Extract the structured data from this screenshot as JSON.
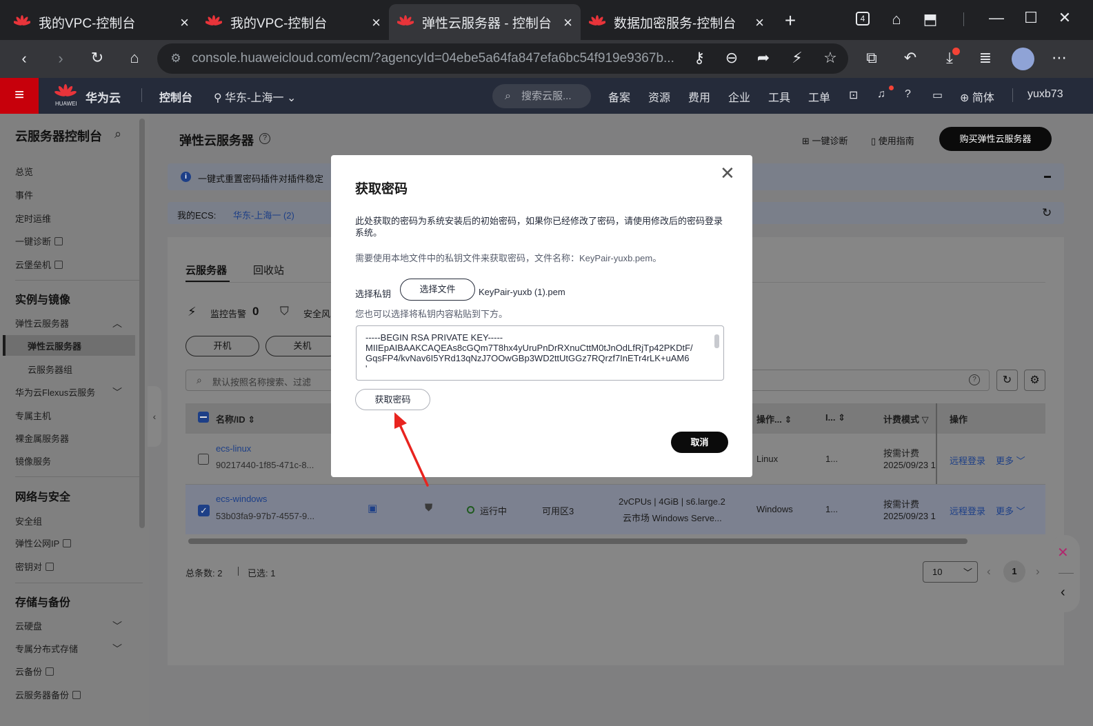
{
  "browser": {
    "tabs": [
      {
        "title": "我的VPC-控制台",
        "close": "×"
      },
      {
        "title": "我的VPC-控制台",
        "close": "×"
      },
      {
        "title": "弹性云服务器 - 控制台",
        "close": "×"
      },
      {
        "title": "数据加密服务-控制台",
        "close": "×"
      }
    ],
    "new_tab": "+",
    "tab_count": "4",
    "url": "console.huaweicloud.com/ecm/?agencyId=04ebe5a64fa847efa6bc54f919e9367b...",
    "window_controls": {
      "minimize": "—",
      "maximize": "☐",
      "close": "✕"
    }
  },
  "header": {
    "brand_text": "华为云",
    "brand_small": "HUAWEI",
    "console": "控制台",
    "region": "华东-上海一",
    "search_placeholder": "搜索云服...",
    "nav": [
      "备案",
      "资源",
      "费用",
      "企业",
      "工具",
      "工单"
    ],
    "language": "简体",
    "user": "yuxb73"
  },
  "sidebar": {
    "title": "云服务器控制台",
    "items_top": [
      "总览",
      "事件",
      "定时运维",
      "一键诊断",
      "云堡垒机"
    ],
    "group_instances": "实例与镜像",
    "instances": [
      "弹性云服务器",
      "弹性云服务器",
      "云服务器组",
      "华为云Flexus云服务",
      "专属主机",
      "裸金属服务器",
      "镜像服务"
    ],
    "group_network": "网络与安全",
    "network": [
      "安全组",
      "弹性公网IP",
      "密钥对"
    ],
    "group_storage": "存储与备份",
    "storage": [
      "云硬盘",
      "专属分布式存储",
      "云备份",
      "云服务器备份"
    ]
  },
  "main": {
    "title": "弹性云服务器",
    "diagnose": "一键诊断",
    "guide": "使用指南",
    "buy_button": "购买弹性云服务器",
    "notice": "一键式重置密码插件对插件稳定",
    "my_ecs_label": "我的ECS:",
    "my_ecs_region": "华东-上海一 (2)",
    "tabs": [
      "云服务器",
      "回收站"
    ],
    "alarm_label": "监控告警",
    "alarm_count": "0",
    "security_label": "安全风",
    "btn_start": "开机",
    "btn_stop": "关机",
    "filter_placeholder": "默认按照名称搜索、过滤",
    "columns": {
      "name": "名称/ID",
      "os": "操作...",
      "i": "I...",
      "billing": "计费模式",
      "ops": "操作"
    },
    "rows": [
      {
        "name": "ecs-linux",
        "id": "90217440-1f85-471c-8...",
        "os": "Linux",
        "i": "1...",
        "billing": "按需计费",
        "date": "2025/09/23 1",
        "remote": "远程登录",
        "more": "更多"
      },
      {
        "name": "ecs-windows",
        "id": "53b03fa9-97b7-4557-9...",
        "status": "运行中",
        "az": "可用区3",
        "spec": "2vCPUs | 4GiB | s6.large.2",
        "image": "云市场  Windows Serve...",
        "os": "Windows",
        "i": "1...",
        "billing": "按需计费",
        "date": "2025/09/23 1",
        "remote": "远程登录",
        "more": "更多"
      }
    ],
    "total": "总条数:  2",
    "selected": "已选:  1",
    "page_size": "10",
    "page": "1"
  },
  "modal": {
    "title": "获取密码",
    "desc1": "此处获取的密码为系统安装后的初始密码，如果你已经修改了密码，请使用修改后的密码登录系统。",
    "desc2": "需要使用本地文件中的私钥文件来获取密码，文件名称：KeyPair-yuxb.pem。",
    "select_label": "选择私钥",
    "select_button": "选择文件",
    "file_name": "KeyPair-yuxb (1).pem",
    "paste_hint": "您也可以选择将私钥内容粘贴到下方。",
    "key_text": "-----BEGIN RSA PRIVATE KEY-----\nMIIEpAIBAAKCAQEAs8cGQm7T8hx4yUruPnDrRXnuCttM0tJnOdLfRjTp42PKDtF/\nGqsFP4/kvNav6I5YRd13qNzJ7OOwGBp3WD2ttUtGGz7RQrzf7InETr4rLK+uAM6\n'",
    "get_button": "获取密码",
    "cancel_button": "取消"
  },
  "colors": {
    "brand_red": "#c7000b",
    "arrow": "#e8241f",
    "header": "#252b3a"
  }
}
